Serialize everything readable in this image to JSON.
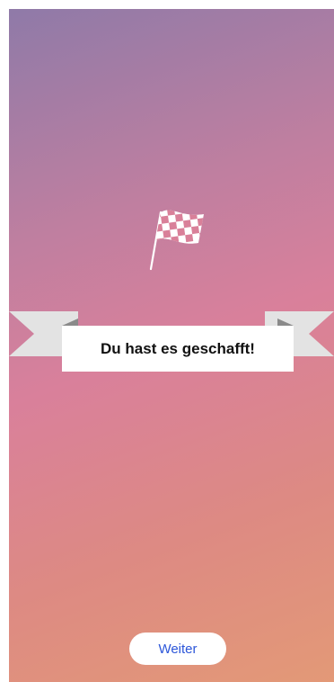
{
  "celebration": {
    "icon": "checkered-flag-icon",
    "message": "Du hast es geschafft!"
  },
  "footer": {
    "continue_label": "Weiter"
  },
  "colors": {
    "gradient_top": "#8f7aa8",
    "gradient_mid": "#d9809b",
    "gradient_bottom": "#e39977",
    "button_text": "#2c56d9"
  }
}
